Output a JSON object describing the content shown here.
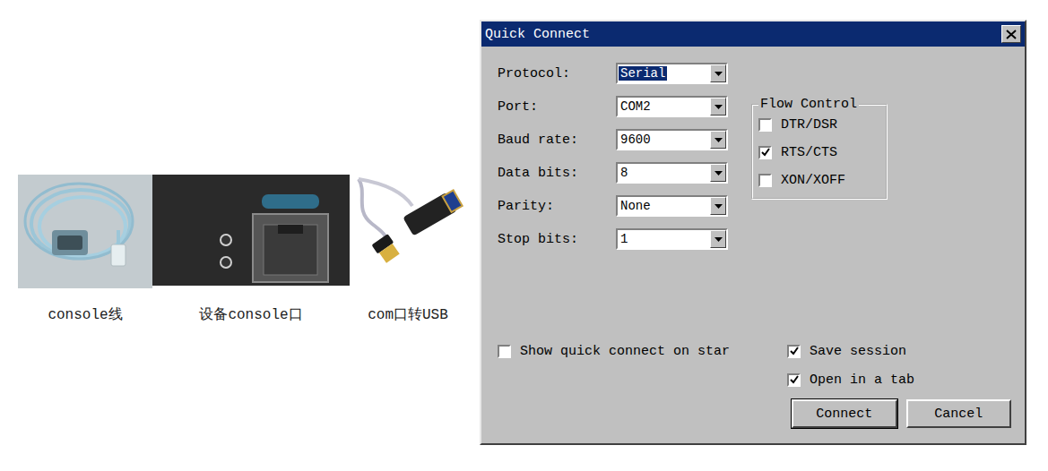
{
  "photos": [
    {
      "kind": "cable",
      "caption": "console线"
    },
    {
      "kind": "port",
      "caption": "设备console口"
    },
    {
      "kind": "adapter",
      "caption": "com口转USB"
    }
  ],
  "window": {
    "title": "Quick Connect"
  },
  "fields": [
    {
      "label": "Protocol:",
      "value": "Serial",
      "highlighted": true
    },
    {
      "label": "Port:",
      "value": "COM2",
      "highlighted": false
    },
    {
      "label": "Baud rate:",
      "value": "9600",
      "highlighted": false
    },
    {
      "label": "Data bits:",
      "value": "8",
      "highlighted": false
    },
    {
      "label": "Parity:",
      "value": "None",
      "highlighted": false
    },
    {
      "label": "Stop bits:",
      "value": "1",
      "highlighted": false
    }
  ],
  "flow_control": {
    "title": "Flow Control",
    "items": [
      {
        "label": "DTR/DSR",
        "checked": false
      },
      {
        "label": "RTS/CTS",
        "checked": true
      },
      {
        "label": "XON/XOFF",
        "checked": false
      }
    ]
  },
  "options": [
    {
      "label": "Show quick connect on star",
      "checked": false
    },
    {
      "label": "Save session",
      "checked": true
    },
    {
      "label": "Open in a tab",
      "checked": true
    }
  ],
  "buttons": [
    "Connect",
    "Cancel"
  ]
}
